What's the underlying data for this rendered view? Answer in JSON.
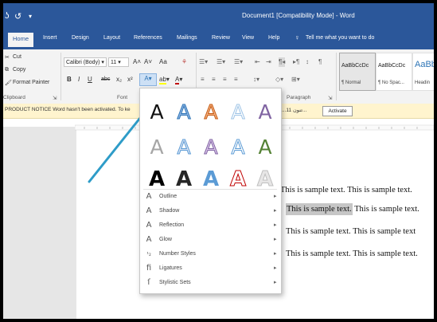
{
  "title_bar": {
    "quick_access": [
      "ʖ",
      "↺",
      "▾"
    ],
    "document_title": "Document1 [Compatibility Mode] - Word"
  },
  "tabs": [
    "Home",
    "Insert",
    "Design",
    "Layout",
    "References",
    "Mailings",
    "Review",
    "View",
    "Help"
  ],
  "tell_me": {
    "icon": "lightbulb-icon",
    "text": "Tell me what you want to do"
  },
  "clipboard": {
    "cut": "Cut",
    "copy": "Copy",
    "format_painter": "Format Painter",
    "group_label": "Clipboard"
  },
  "font": {
    "name": "Calibri (Body)",
    "size": "11",
    "grow": "A˄",
    "shrink": "A˅",
    "change_case": "Aa",
    "clear": "⚘",
    "bold": "B",
    "italic": "I",
    "underline": "U",
    "strikethrough": "abc",
    "subscript": "x₂",
    "superscript": "x²",
    "text_effects": "A",
    "highlight": "ab",
    "font_color": "A",
    "group_label": "Font"
  },
  "paragraph": {
    "group_label": "Paragraph",
    "pilcrow": "¶"
  },
  "styles": [
    {
      "sample": "AaBbCcDc",
      "name": "¶ Normal"
    },
    {
      "sample": "AaBbCcDc",
      "name": "¶ No Spac..."
    },
    {
      "sample": "AaBb",
      "name": "Headin"
    }
  ],
  "notice": {
    "text": "PRODUCT NOTICE   Word hasn't been activated. To ke",
    "activate_label": "Activate",
    "right_text": "...تنون 11..."
  },
  "document": {
    "lines": [
      {
        "pre": "This is sample text. This is sample text.",
        "highlight": "",
        "post": ""
      },
      {
        "pre": "",
        "highlight": "This is sample text.",
        "post": " This is sample text."
      },
      {
        "pre": "This is sample text. This is sample text",
        "highlight": "",
        "post": ""
      },
      {
        "pre": "This is sample text. This is sample text.",
        "highlight": "",
        "post": ""
      }
    ]
  },
  "text_effects": {
    "gallery": [
      {
        "name": "black-plain",
        "glyph": "A",
        "fill": "#111111",
        "stroke": "none"
      },
      {
        "name": "blue-outline",
        "glyph": "A",
        "fill": "#8db3e2",
        "stroke": "#2e75b6"
      },
      {
        "name": "orange-outline",
        "glyph": "A",
        "fill": "#f4b183",
        "stroke": "#c55a11"
      },
      {
        "name": "grey-outline",
        "glyph": "A",
        "fill": "#ffffff",
        "stroke": "#9dc3e6"
      },
      {
        "name": "purple-gradient",
        "glyph": "A",
        "fill": "#8064a2",
        "stroke": "none"
      },
      {
        "name": "grey-shadow",
        "glyph": "A",
        "fill": "#a6a6a6",
        "stroke": "none"
      },
      {
        "name": "blue-reflect",
        "glyph": "A",
        "fill": "#dae3f3",
        "stroke": "#5b9bd5"
      },
      {
        "name": "lavender-outline",
        "glyph": "A",
        "fill": "#d9c3e9",
        "stroke": "#8064a2"
      },
      {
        "name": "light-blue-outline",
        "glyph": "A",
        "fill": "#ffffff",
        "stroke": "#5b9bd5"
      },
      {
        "name": "green-fill",
        "glyph": "A",
        "fill": "#548235",
        "stroke": "none"
      },
      {
        "name": "black-bold",
        "glyph": "A",
        "fill": "#000000",
        "stroke": "none"
      },
      {
        "name": "dark-bold",
        "glyph": "A",
        "fill": "#262626",
        "stroke": "none"
      },
      {
        "name": "teal-bold",
        "glyph": "A",
        "fill": "#5b9bd5",
        "stroke": "none"
      },
      {
        "name": "red-outline",
        "glyph": "A",
        "fill": "#ffffff",
        "stroke": "#c00000"
      },
      {
        "name": "silver-bold",
        "glyph": "A",
        "fill": "#e7e6e6",
        "stroke": "#bfbfbf"
      }
    ],
    "menu": [
      {
        "icon": "A",
        "label": "Outline"
      },
      {
        "icon": "A",
        "label": "Shadow"
      },
      {
        "icon": "A",
        "label": "Reflection"
      },
      {
        "icon": "A",
        "label": "Glow"
      },
      {
        "icon": "¹₂",
        "label": "Number Styles"
      },
      {
        "icon": "fi",
        "label": "Ligatures"
      },
      {
        "icon": "ſ",
        "label": "Stylistic Sets"
      }
    ],
    "submenu_arrow": "▸"
  },
  "colors": {
    "title_blue": "#2b579a",
    "arrow": "#2e9cc8",
    "notice_bg": "#fff4ce"
  }
}
